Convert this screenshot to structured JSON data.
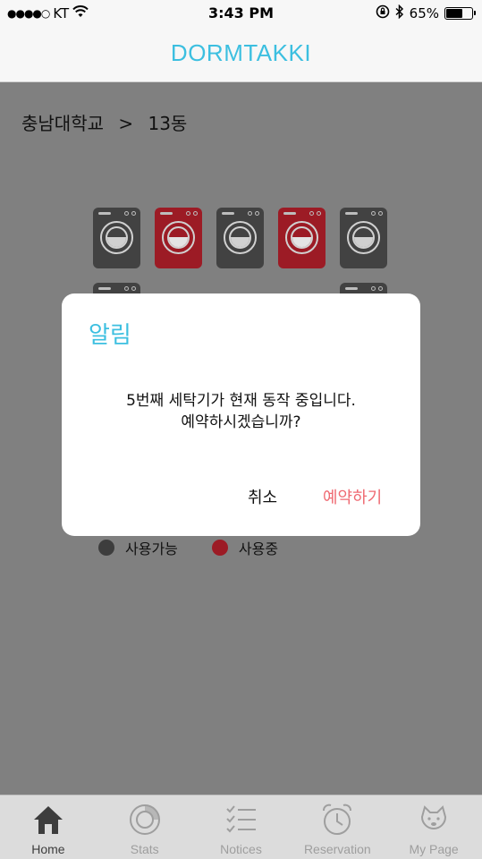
{
  "status_bar": {
    "carrier": "KT",
    "time": "3:43 PM",
    "battery_percent": "65%",
    "battery_level": 0.65,
    "signal_dots": "●●●●○"
  },
  "nav": {
    "title": "DORMTAKKI"
  },
  "breadcrumb": {
    "school": "충남대학교",
    "separator": ">",
    "building": "13동"
  },
  "machines": [
    {
      "status": "free"
    },
    {
      "status": "busy"
    },
    {
      "status": "free"
    },
    {
      "status": "busy"
    },
    {
      "status": "free"
    }
  ],
  "legend": {
    "available": "사용가능",
    "in_use": "사용중"
  },
  "modal": {
    "title": "알림",
    "message_line1": "5번째 세탁기가 현재 동작 중입니다.",
    "message_line2": "예약하시겠습니까?",
    "cancel_label": "취소",
    "confirm_label": "예약하기"
  },
  "tabs": [
    {
      "label": "Home",
      "icon": "home-icon",
      "active": true
    },
    {
      "label": "Stats",
      "icon": "stats-icon",
      "active": false
    },
    {
      "label": "Notices",
      "icon": "notices-icon",
      "active": false
    },
    {
      "label": "Reservation",
      "icon": "alarm-clock-icon",
      "active": false
    },
    {
      "label": "My Page",
      "icon": "dog-icon",
      "active": false
    }
  ],
  "colors": {
    "accent": "#3cbfe0",
    "busy": "#9c1b25",
    "free": "#424242",
    "confirm": "#ef6a72"
  }
}
